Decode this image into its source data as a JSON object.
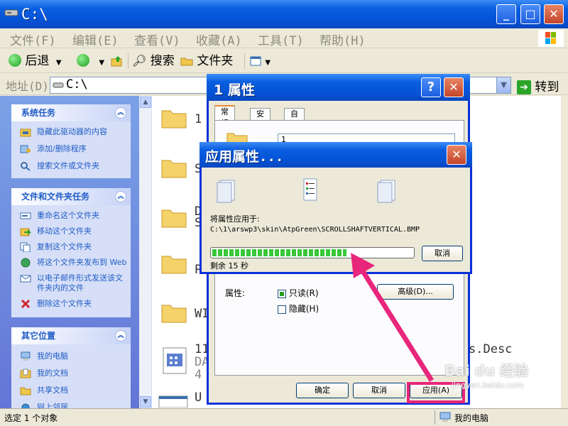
{
  "window": {
    "title": "C:\\",
    "minimize": "_",
    "maximize": "□",
    "close": "✕"
  },
  "menu": {
    "items": [
      "文件(F)",
      "编辑(E)",
      "查看(V)",
      "收藏(A)",
      "工具(T)",
      "帮助(H)"
    ]
  },
  "toolbar": {
    "back": "后退",
    "search": "搜索",
    "folders": "文件夹"
  },
  "address": {
    "label": "地址(D)",
    "value": "C:\\",
    "go": "转到"
  },
  "tasks": {
    "system": {
      "title": "系统任务",
      "items": [
        "隐藏此驱动器的内容",
        "添加/删除程序",
        "搜索文件或文件夹"
      ]
    },
    "file_folder": {
      "title": "文件和文件夹任务",
      "items": [
        "重命名这个文件夹",
        "移动这个文件夹",
        "复制这个文件夹",
        "将这个文件夹发布到 Web",
        "以电子邮件形式发送该文件夹内的文件",
        "删除这个文件夹"
      ]
    },
    "other": {
      "title": "其它位置",
      "items": [
        "我的电脑",
        "我的文档",
        "共享文档",
        "网上邻居"
      ]
    }
  },
  "files": {
    "items": [
      "1",
      "S",
      "D",
      "S",
      "P",
      "WI",
      "11",
      "DA",
      "4",
      "U"
    ],
    "right_text": "s.Desc"
  },
  "status": {
    "selected": "选定 1 个对象",
    "location": "我的电脑"
  },
  "props": {
    "title": "1 属性",
    "tabs": [
      "常规",
      "安全",
      "自定义"
    ],
    "name_value": "1",
    "attr_label": "属性:",
    "readonly": "只读(R)",
    "hidden": "隐藏(H)",
    "advanced": "高级(D)...",
    "ok": "确定",
    "cancel": "取消",
    "apply": "应用(A)"
  },
  "apply_dialog": {
    "title": "应用属性...",
    "applying_label": "将属性应用于:",
    "path": "C:\\1\\arswp3\\skin\\AtpGreen\\SCROLLSHAFTVERTICAL.BMP",
    "progress": 0.67,
    "remaining": "剩余 15 秒",
    "cancel": "取消"
  },
  "watermark": {
    "text": "jingyan.baidu.com",
    "logo_text": "Bai du 经验"
  },
  "colors": {
    "title_blue": "#0553d6",
    "highlight": "#e8267b",
    "progress_green": "#38c838",
    "link_blue": "#215dc6"
  }
}
